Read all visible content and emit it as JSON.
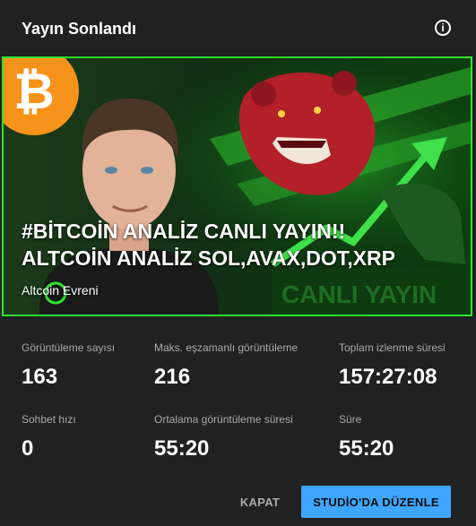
{
  "header": {
    "title": "Yayın Sonlandı",
    "info_icon": "info-icon"
  },
  "thumbnail": {
    "title_line1": "#BİTCOİN ANALİZ CANLI YAYIN!!",
    "title_line2": "ALTCOİN ANALİZ SOL,AVAX,DOT,XRP",
    "channel": "Altcoin Evreni",
    "badge_text": "CANLI YAYIN",
    "border_color": "#2ee62e"
  },
  "stats": [
    {
      "label": "Görüntüleme sayısı",
      "value": "163"
    },
    {
      "label": "Maks. eşzamanlı görüntüleme",
      "value": "216"
    },
    {
      "label": "Toplam izlenme süresi",
      "value": "157:27:08"
    },
    {
      "label": "Sohbet hızı",
      "value": "0"
    },
    {
      "label": "Ortalama görüntüleme süresi",
      "value": "55:20"
    },
    {
      "label": "Süre",
      "value": "55:20"
    }
  ],
  "footer": {
    "close_label": "KAPAT",
    "edit_label": "STUDİO'DA DÜZENLE",
    "edit_color": "#3ea6ff"
  }
}
